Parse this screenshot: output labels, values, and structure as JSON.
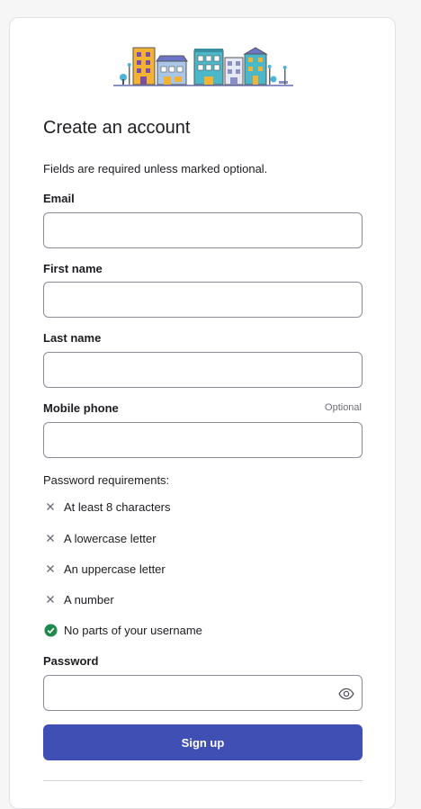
{
  "form": {
    "title": "Create an account",
    "hint": "Fields are required unless marked optional.",
    "email": {
      "label": "Email",
      "value": ""
    },
    "first_name": {
      "label": "First name",
      "value": ""
    },
    "last_name": {
      "label": "Last name",
      "value": ""
    },
    "mobile_phone": {
      "label": "Mobile phone",
      "optional_label": "Optional",
      "value": ""
    },
    "password_requirements": {
      "title": "Password requirements:",
      "items": [
        {
          "label": "At least 8 characters",
          "status": "unmet",
          "icon": "x-icon"
        },
        {
          "label": "A lowercase letter",
          "status": "unmet",
          "icon": "x-icon"
        },
        {
          "label": "An uppercase letter",
          "status": "unmet",
          "icon": "x-icon"
        },
        {
          "label": "A number",
          "status": "unmet",
          "icon": "x-icon"
        },
        {
          "label": "No parts of your username",
          "status": "met",
          "icon": "check-circle-icon"
        }
      ]
    },
    "password": {
      "label": "Password",
      "value": "",
      "toggle_icon": "eye-icon"
    },
    "submit_label": "Sign up"
  },
  "colors": {
    "primary_button": "#3f4fb4",
    "met_check": "#1e8a4c",
    "unmet_x": "#6e6e78"
  }
}
